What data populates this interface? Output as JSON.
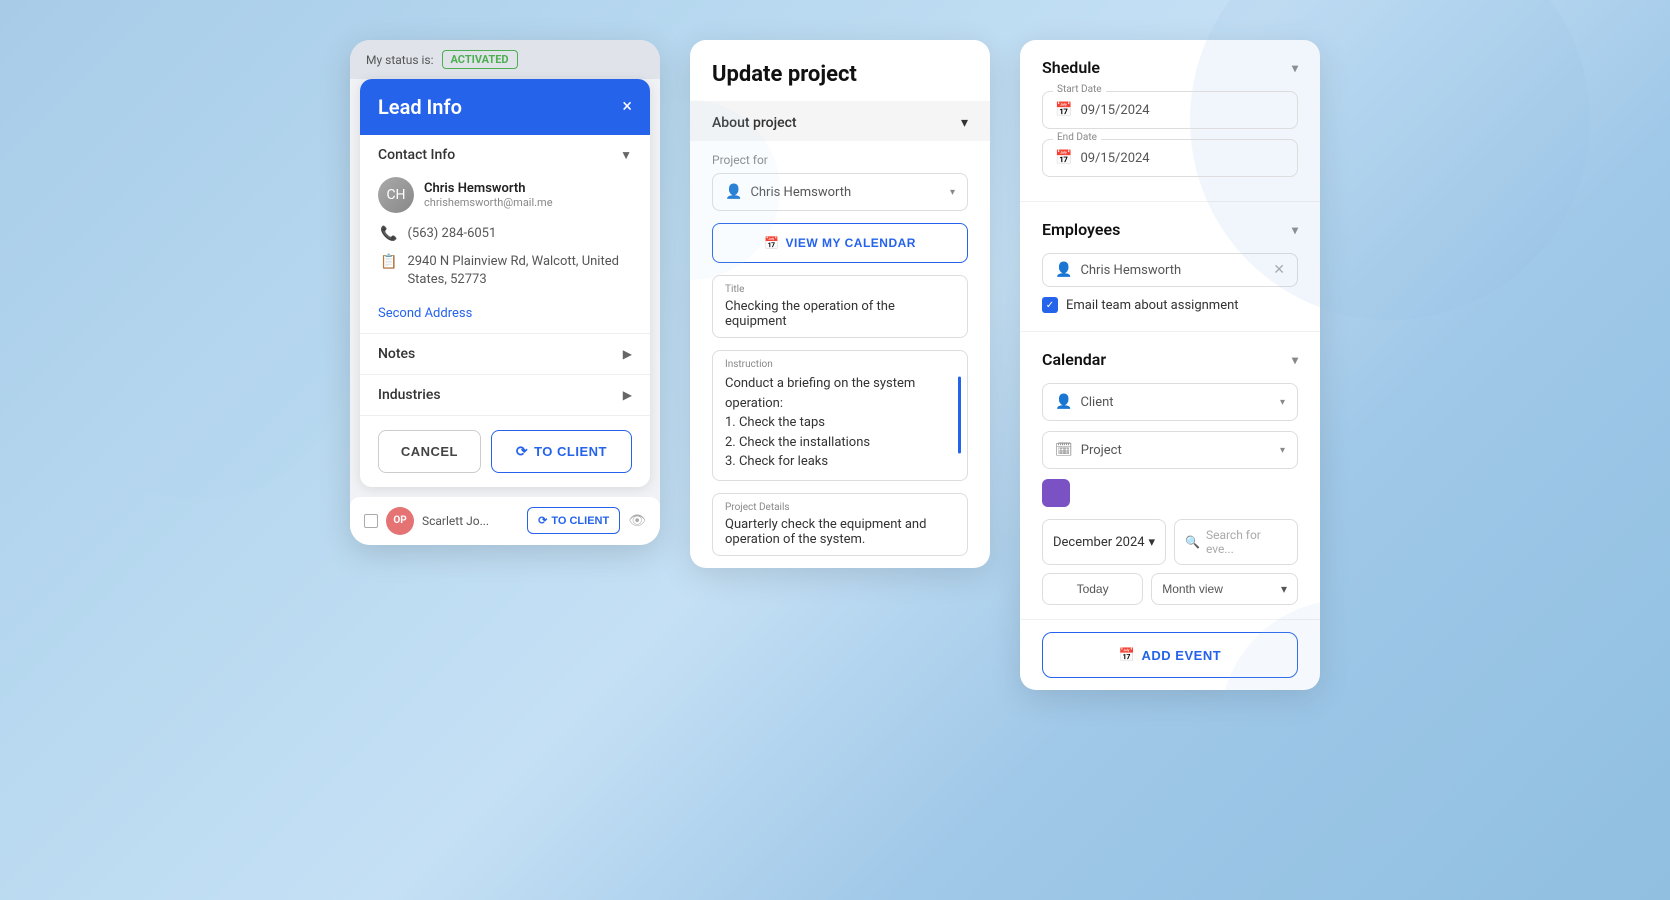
{
  "background": "#a8cce8",
  "panel1": {
    "status_label": "My status is:",
    "status_badge": "ACTIVATED",
    "modal_title": "Lead Info",
    "close_icon": "×",
    "contact_info_label": "Contact Info",
    "person_name": "Chris Hemsworth",
    "person_email": "chrishemsworth@mail.me",
    "phone": "(563) 284-6051",
    "address": "2940 N Plainview Rd, Walcott, United States, 52773",
    "second_address_link": "Second Address",
    "notes_label": "Notes",
    "industries_label": "Industries",
    "cancel_btn": "CANCEL",
    "to_client_btn": "TO CLIENT",
    "sync_icon": "⟳",
    "bottom_avatar": "OP",
    "bottom_name": "Scarlett Jo...",
    "bottom_to_client": "TO CLIENT",
    "eye_icon": "👁"
  },
  "panel2": {
    "title": "Update project",
    "about_project_label": "About project",
    "project_for_label": "Project for",
    "project_for_value": "Chris Hemsworth",
    "view_calendar_btn": "VIEW MY CALENDAR",
    "title_label": "Title",
    "title_value": "Checking the operation of the equipment",
    "instruction_label": "Instruction",
    "instruction_value": "Conduct a briefing on the system operation:\n1. Check the taps\n2. Check the installations\n3. Check for leaks",
    "project_details_label": "Project Details",
    "project_details_value": "Quarterly check the equipment and operation of the system."
  },
  "panel3": {
    "schedule_title": "Shedule",
    "start_date_label": "Start Date",
    "start_date_value": "09/15/2024",
    "end_date_label": "End Date",
    "end_date_value": "09/15/2024",
    "employees_title": "Employees",
    "employee_name": "Chris Hemsworth",
    "email_team_label": "Email team about assignment",
    "calendar_title": "Calendar",
    "client_placeholder": "Client",
    "project_placeholder": "Project",
    "month_value": "December 2024",
    "search_placeholder": "Search for eve...",
    "today_btn": "Today",
    "month_view_btn": "Month view",
    "add_event_btn": "ADD EVENT",
    "calendar_icon": "📅",
    "search_icon": "🔍"
  }
}
